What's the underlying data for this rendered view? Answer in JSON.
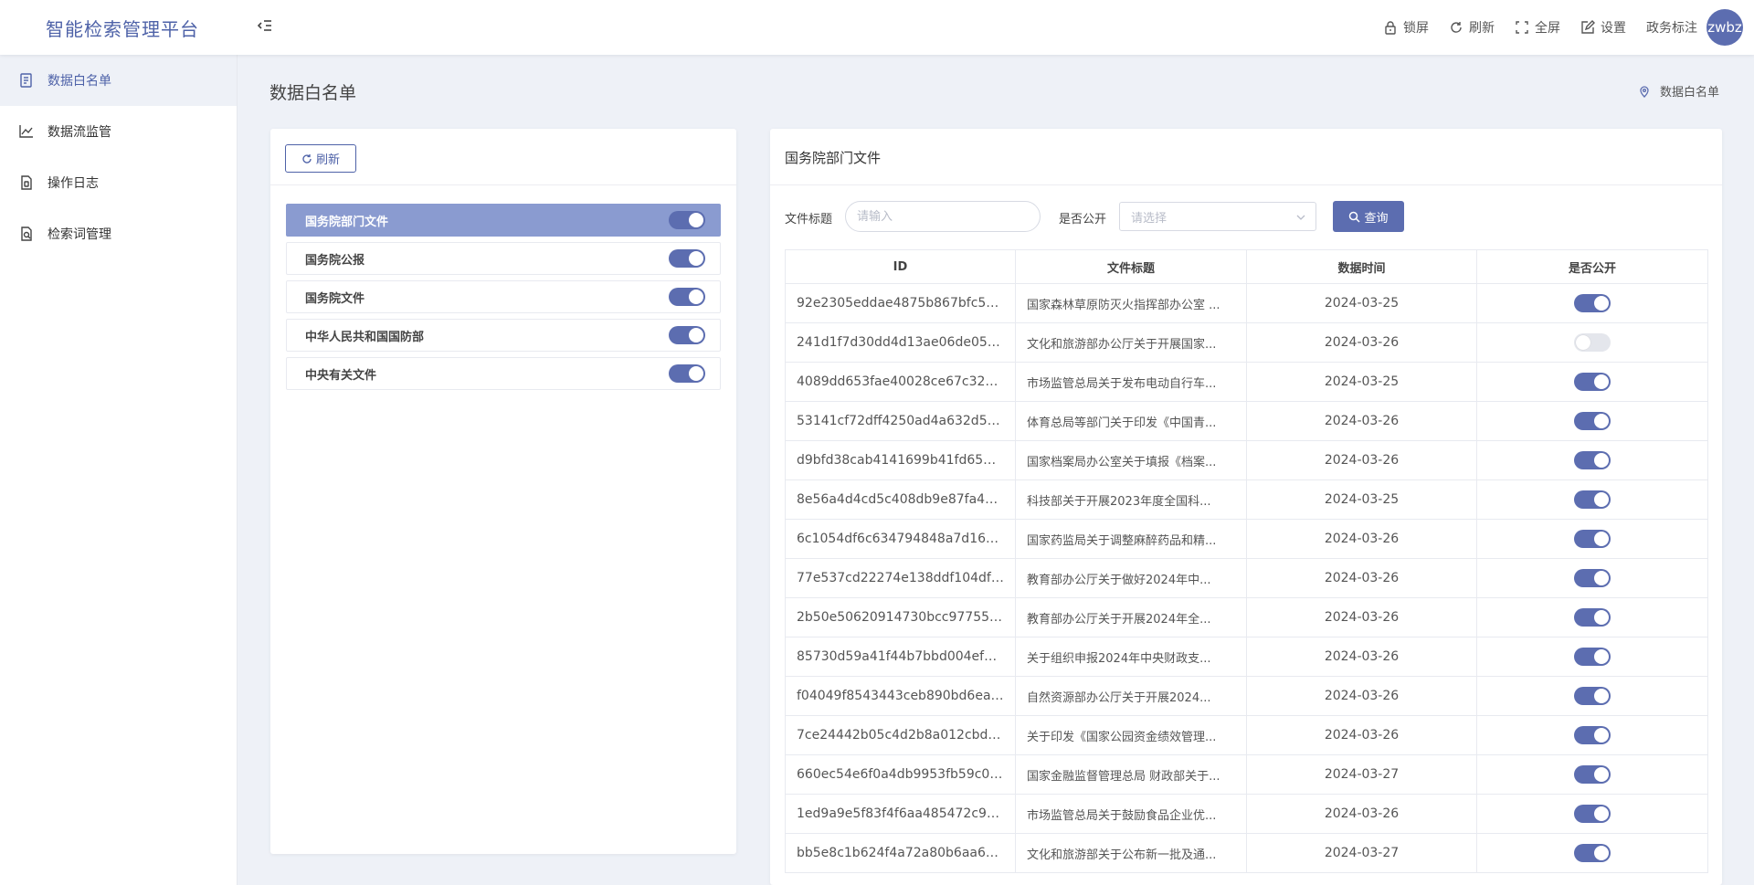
{
  "app": {
    "title": "智能检索管理平台"
  },
  "header": {
    "actions": [
      {
        "label": "锁屏",
        "icon": "lock-icon"
      },
      {
        "label": "刷新",
        "icon": "refresh-icon"
      },
      {
        "label": "全屏",
        "icon": "fullscreen-icon"
      },
      {
        "label": "设置",
        "icon": "settings-icon"
      },
      {
        "label": "政务标注",
        "icon": ""
      }
    ],
    "avatar_text": "zwbz"
  },
  "sidebar": {
    "items": [
      {
        "label": "数据白名单",
        "icon": "document-list-icon",
        "active": true
      },
      {
        "label": "数据流监管",
        "icon": "line-chart-icon",
        "active": false
      },
      {
        "label": "操作日志",
        "icon": "log-icon",
        "active": false
      },
      {
        "label": "检索词管理",
        "icon": "search-doc-icon",
        "active": false
      }
    ]
  },
  "page": {
    "title": "数据白名单",
    "breadcrumb": "数据白名单"
  },
  "left_panel": {
    "refresh_label": "刷新",
    "categories": [
      {
        "label": "国务院部门文件",
        "enabled": true,
        "active": true
      },
      {
        "label": "国务院公报",
        "enabled": true,
        "active": false
      },
      {
        "label": "国务院文件",
        "enabled": true,
        "active": false
      },
      {
        "label": "中华人民共和国国防部",
        "enabled": true,
        "active": false
      },
      {
        "label": "中央有关文件",
        "enabled": true,
        "active": false
      }
    ]
  },
  "right_panel": {
    "title": "国务院部门文件",
    "filters": {
      "title_label": "文件标题",
      "title_placeholder": "请输入",
      "title_value": "",
      "public_label": "是否公开",
      "public_placeholder": "请选择",
      "query_label": "查询"
    },
    "table": {
      "columns": [
        "ID",
        "文件标题",
        "数据时间",
        "是否公开"
      ],
      "rows": [
        {
          "id": "92e2305eddae4875b867bfc545...",
          "title": "国家森林草原防灭火指挥部办公室 ...",
          "date": "2024-03-25",
          "public": true
        },
        {
          "id": "241d1f7d30dd4d13ae06de051c...",
          "title": "文化和旅游部办公厅关于开展国家...",
          "date": "2024-03-26",
          "public": false
        },
        {
          "id": "4089dd653fae40028ce67c327b...",
          "title": "市场监管总局关于发布电动自行车...",
          "date": "2024-03-25",
          "public": true
        },
        {
          "id": "53141cf72dff4250ad4a632d5b5...",
          "title": "体育总局等部门关于印发《中国青...",
          "date": "2024-03-26",
          "public": true
        },
        {
          "id": "d9bfd38cab4141699b41fd651ef...",
          "title": "国家档案局办公室关于填报《档案...",
          "date": "2024-03-26",
          "public": true
        },
        {
          "id": "8e56a4d4cd5c408db9e87fa4e4...",
          "title": "科技部关于开展2023年度全国科...",
          "date": "2024-03-25",
          "public": true
        },
        {
          "id": "6c1054df6c634794848a7d1648...",
          "title": "国家药监局关于调整麻醉药品和精...",
          "date": "2024-03-26",
          "public": true
        },
        {
          "id": "77e537cd22274e138ddf104dfe9...",
          "title": "教育部办公厅关于做好2024年中...",
          "date": "2024-03-26",
          "public": true
        },
        {
          "id": "2b50e50620914730bcc9775570...",
          "title": "教育部办公厅关于开展2024年全...",
          "date": "2024-03-26",
          "public": true
        },
        {
          "id": "85730d59a41f44b7bbd004efdef...",
          "title": "关于组织申报2024年中央财政支...",
          "date": "2024-03-26",
          "public": true
        },
        {
          "id": "f04049f8543443ceb890bd6ea4e...",
          "title": "自然资源部办公厅关于开展2024...",
          "date": "2024-03-26",
          "public": true
        },
        {
          "id": "7ce24442b05c4d2b8a012cbd11...",
          "title": "关于印发《国家公园资金绩效管理...",
          "date": "2024-03-26",
          "public": true
        },
        {
          "id": "660ec54e6f0a4db9953fb59c0c0...",
          "title": "国家金融监督管理总局 财政部关于...",
          "date": "2024-03-27",
          "public": true
        },
        {
          "id": "1ed9a9e5f83f4f6aa485472c9c64...",
          "title": "市场监管总局关于鼓励食品企业优...",
          "date": "2024-03-26",
          "public": true
        },
        {
          "id": "bb5e8c1b624f4a72a80b6aa6b3...",
          "title": "文化和旅游部关于公布新一批及通...",
          "date": "2024-03-27",
          "public": true
        }
      ]
    }
  },
  "colors": {
    "primary": "#5c6db0",
    "brand_text": "#4e62a8",
    "active_category_bg": "#8a9bd0",
    "toggle_off": "#e4e6ec",
    "page_bg": "#eef1f7"
  }
}
